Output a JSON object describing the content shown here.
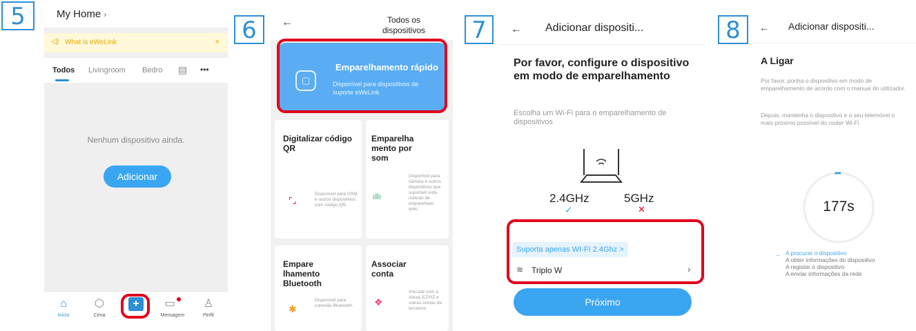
{
  "steps": {
    "s5": "5",
    "s6": "6",
    "s7": "7",
    "s8": "8"
  },
  "panel5": {
    "home_title": "My Home",
    "home_chevron": "›",
    "banner_icon": "speaker-icon",
    "banner_icon_glyph": "◁)",
    "banner_text": "What is eWeLink",
    "banner_close": "×",
    "tabs": [
      "Todos",
      "Livingroom",
      "Bedroc"
    ],
    "tab_list_icon": "▤",
    "tab_more": "•••",
    "empty_text": "Nenhum dispositivo ainda.",
    "add_button": "Adicionar",
    "nav": [
      {
        "label": "Início",
        "icon": "home-icon",
        "glyph": "⌂"
      },
      {
        "label": "Cena",
        "icon": "scene-icon",
        "glyph": "⬡"
      },
      {
        "label": "",
        "icon": "plus-icon",
        "glyph": "+"
      },
      {
        "label": "Mensagem",
        "icon": "message-icon",
        "glyph": "▭"
      },
      {
        "label": "Perfil",
        "icon": "profile-icon",
        "glyph": "♙"
      }
    ]
  },
  "panel6": {
    "back": "←",
    "title": "Todos os dispositivos",
    "quick_title": "Emparelhamento rápido",
    "quick_desc": "Disponível para dispositivos de suporte eWeLink",
    "cards": [
      {
        "title": "Digitalizar código QR",
        "desc": "Disponível para GSM e outros dispositivos com código QR.",
        "icon": "qr-scan-icon",
        "glyph": "⌜⌟"
      },
      {
        "title": "Emparelha mento por som",
        "desc": "Disponível para câmara e outros dispositivos que suportam este método de emparelham ento.",
        "icon": "sound-wave-icon",
        "glyph": "ıllı"
      },
      {
        "title": "Empare lhamento Bluetooth",
        "desc": "Disponível para conexão Bluetooth.",
        "icon": "bluetooth-icon",
        "glyph": "✱"
      },
      {
        "title": "Associar conta",
        "desc": "Vincular com a Alexa, EZVIZ e outras contas de terceiros.",
        "icon": "account-link-icon",
        "glyph": "❖"
      }
    ]
  },
  "panel7": {
    "back": "←",
    "title": "Adicionar dispositi...",
    "heading": "Por favor, configure o dispositivo em modo de emparelhamento",
    "subtitle": "Escolha um Wi-Fi para o emparelhamento de dispositivos",
    "freq_24": "2.4GHz",
    "freq_5": "5GHz",
    "check": "✓",
    "cross": "✕",
    "chip": "Suporta apenas WI-FI 2.4Ghz >",
    "wifi_glyph": "≋",
    "ssid": "Triplo W",
    "chevron": "›",
    "next_button": "Próximo"
  },
  "panel8": {
    "back": "←",
    "title": "Adicionar dispositi...",
    "heading": "A Ligar",
    "desc1": "Por favor, ponha o dispositivo em modo de emparelhamento de acordo com o manual do utilizador.",
    "desc2": "Depois, mantenha o dispositivo e o seu telemóvel o mais próximo possível do router Wi-Fi.",
    "timer": "177s",
    "spinner": "⌣",
    "steps": [
      "A procurar o dispositivo",
      "A obter informações do dispositivo",
      "A registar o dispositivo",
      "A enviar informações da rede"
    ],
    "progress_fraction": 0.02
  },
  "colors": {
    "accent": "#3aa5f0",
    "highlight": "#e0001b",
    "step_label": "#2b8fd6"
  }
}
